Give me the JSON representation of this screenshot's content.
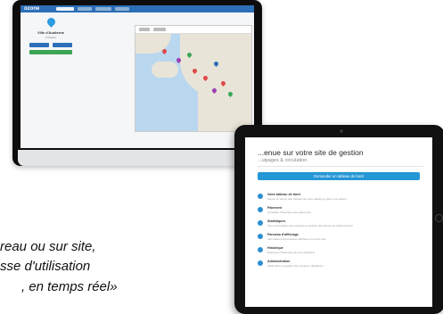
{
  "desktop": {
    "app": {
      "logo": "ozone",
      "nav_items": 5
    },
    "place": {
      "name": "Ville d'Audierne",
      "subtitle": "Finistère"
    },
    "colors": {
      "nav": "#2c6fb7",
      "pin": "#2c9be0",
      "button_blue": "#2c6fb7",
      "button_green": "#3aa655"
    }
  },
  "tablet": {
    "title": "...enue sur votre site de gestion",
    "subtitle": "...uipages & circulation",
    "cta_label": "Demander un tableau de bord",
    "features": [
      {
        "icon": "map-pin-icon",
        "title": "Votre tableau de bord",
        "desc": "Suivez en temps réel l'activité de votre parking et gérez vos places"
      },
      {
        "icon": "tag-icon",
        "title": "Paiement",
        "desc": "Consultez l'historique des paiements"
      },
      {
        "icon": "user-icon",
        "title": "Statistiques",
        "desc": "Taux d'occupation des parkings et analyse des durées de stationnement"
      },
      {
        "icon": "monitor-icon",
        "title": "Panneau d'affichage",
        "desc": "Informations dynamiques affichées en temps réel"
      },
      {
        "icon": "clock-icon",
        "title": "Historique",
        "desc": "Retrouvez l'historique de vos opérations"
      },
      {
        "icon": "settings-icon",
        "title": "Administration",
        "desc": "Paramètres et gestion des comptes utilisateurs"
      }
    ],
    "colors": {
      "accent": "#2596d6"
    }
  },
  "tagline": {
    "line1": "reau ou sur site,",
    "line2": "sse d'utilisation",
    "line3": ", en temps réel»"
  }
}
